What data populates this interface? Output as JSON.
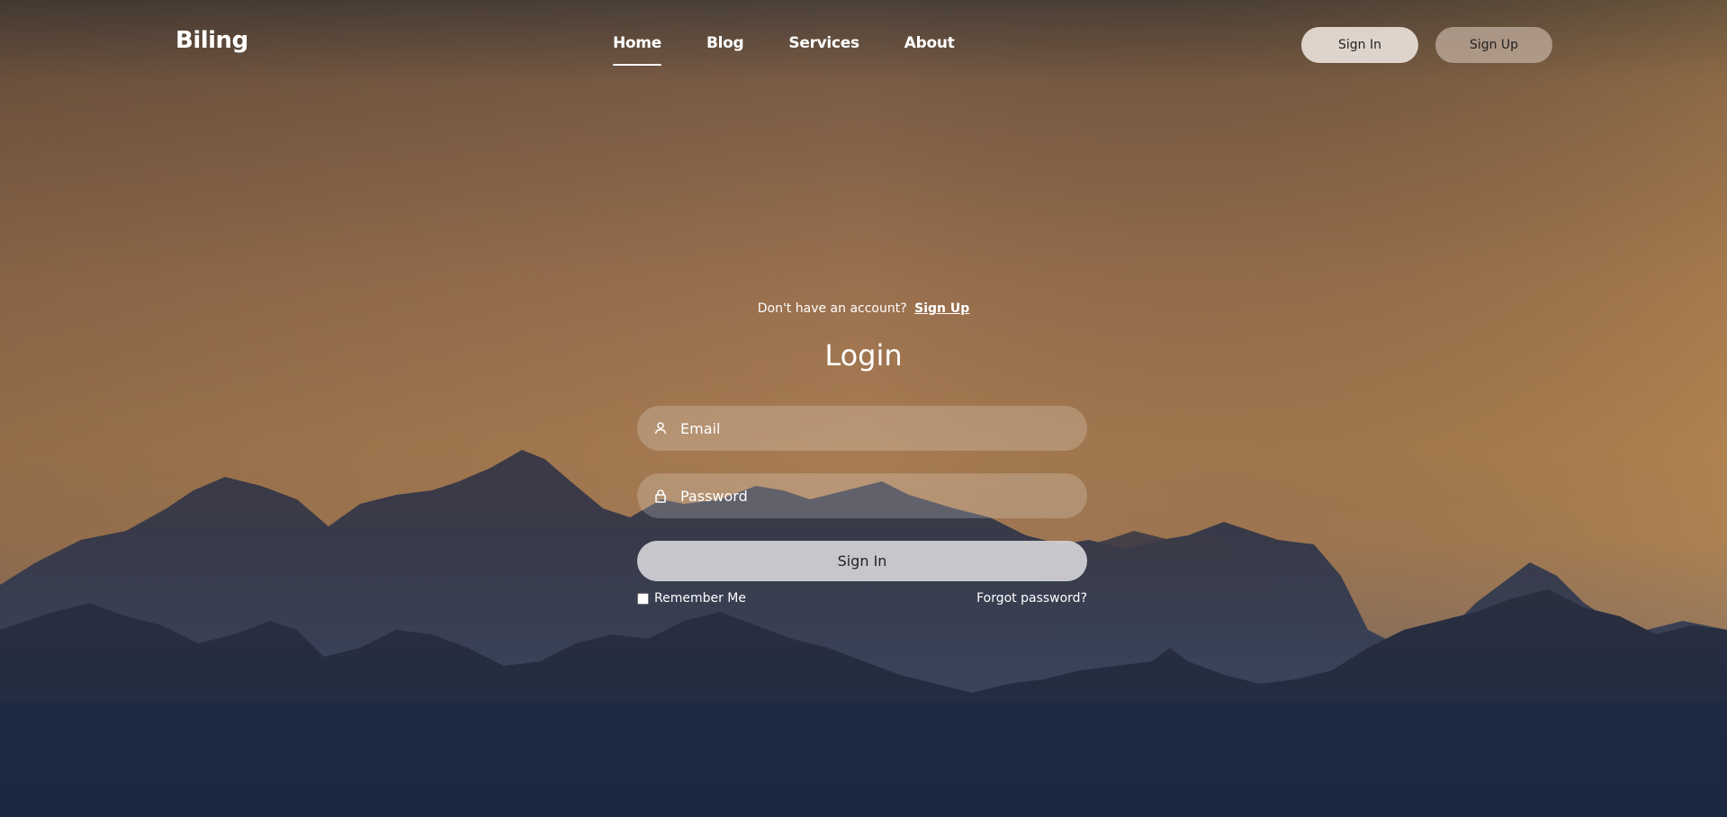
{
  "header": {
    "logo": "Biling",
    "nav": [
      {
        "label": "Home",
        "active": true
      },
      {
        "label": "Blog",
        "active": false
      },
      {
        "label": "Services",
        "active": false
      },
      {
        "label": "About",
        "active": false
      }
    ],
    "sign_in_label": "Sign In",
    "sign_up_label": "Sign Up"
  },
  "login": {
    "prompt_text": "Don't have an account?",
    "prompt_link": "Sign Up",
    "title": "Login",
    "email_placeholder": "Email",
    "password_placeholder": "Password",
    "submit_label": "Sign In",
    "remember_label": "Remember Me",
    "remember_checked": false,
    "forgot_label": "Forgot password?"
  },
  "icons": {
    "email": "user-icon",
    "password": "lock-icon"
  },
  "colors": {
    "sky_top": "#5a4a3e",
    "sky_mid": "#a9784f",
    "mountain_dark": "#1f2b40",
    "mountain_mid": "#383a4a"
  }
}
